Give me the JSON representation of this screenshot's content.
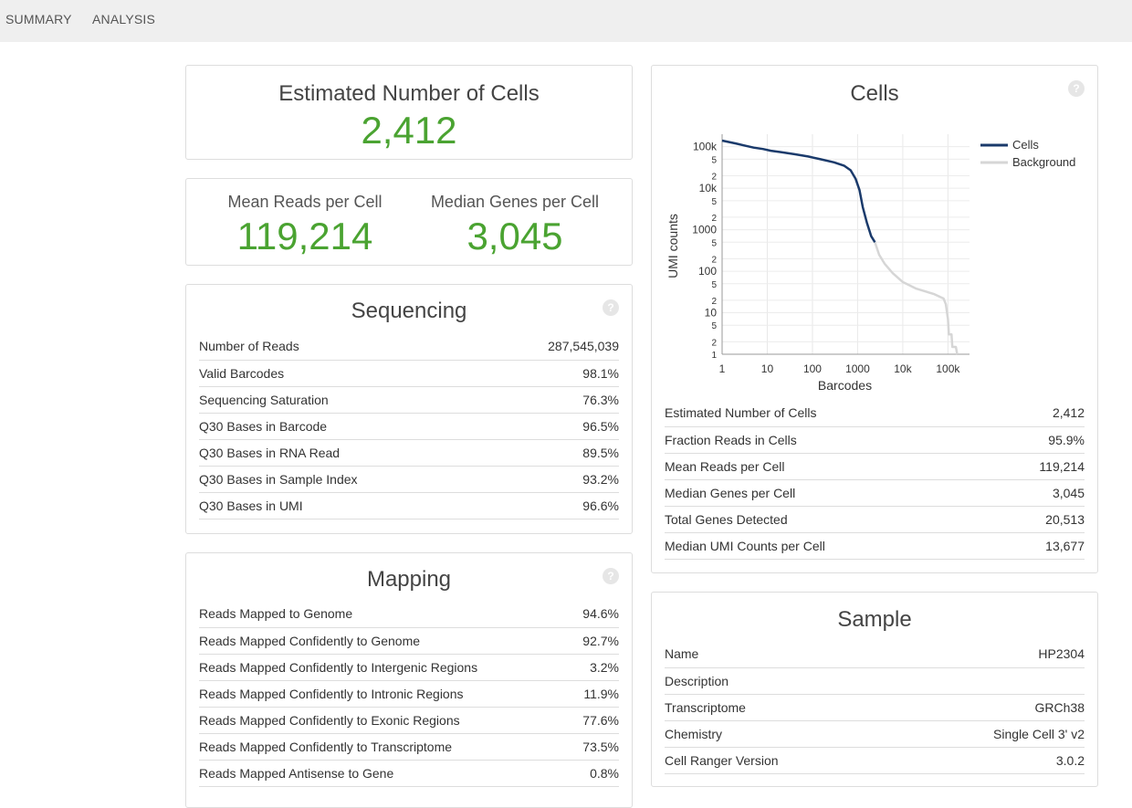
{
  "nav": {
    "tabs": [
      "SUMMARY",
      "ANALYSIS"
    ]
  },
  "estimated_cells": {
    "title": "Estimated Number of Cells",
    "value": "2,412"
  },
  "kpis": [
    {
      "label": "Mean Reads per Cell",
      "value": "119,214"
    },
    {
      "label": "Median Genes per Cell",
      "value": "3,045"
    }
  ],
  "sequencing": {
    "title": "Sequencing",
    "rows": [
      {
        "label": "Number of Reads",
        "value": "287,545,039"
      },
      {
        "label": "Valid Barcodes",
        "value": "98.1%"
      },
      {
        "label": "Sequencing Saturation",
        "value": "76.3%"
      },
      {
        "label": "Q30 Bases in Barcode",
        "value": "96.5%"
      },
      {
        "label": "Q30 Bases in RNA Read",
        "value": "89.5%"
      },
      {
        "label": "Q30 Bases in Sample Index",
        "value": "93.2%"
      },
      {
        "label": "Q30 Bases in UMI",
        "value": "96.6%"
      }
    ]
  },
  "mapping": {
    "title": "Mapping",
    "rows": [
      {
        "label": "Reads Mapped to Genome",
        "value": "94.6%"
      },
      {
        "label": "Reads Mapped Confidently to Genome",
        "value": "92.7%"
      },
      {
        "label": "Reads Mapped Confidently to Intergenic Regions",
        "value": "3.2%"
      },
      {
        "label": "Reads Mapped Confidently to Intronic Regions",
        "value": "11.9%"
      },
      {
        "label": "Reads Mapped Confidently to Exonic Regions",
        "value": "77.6%"
      },
      {
        "label": "Reads Mapped Confidently to Transcriptome",
        "value": "73.5%"
      },
      {
        "label": "Reads Mapped Antisense to Gene",
        "value": "0.8%"
      }
    ]
  },
  "cells": {
    "title": "Cells",
    "rows": [
      {
        "label": "Estimated Number of Cells",
        "value": "2,412"
      },
      {
        "label": "Fraction Reads in Cells",
        "value": "95.9%"
      },
      {
        "label": "Mean Reads per Cell",
        "value": "119,214"
      },
      {
        "label": "Median Genes per Cell",
        "value": "3,045"
      },
      {
        "label": "Total Genes Detected",
        "value": "20,513"
      },
      {
        "label": "Median UMI Counts per Cell",
        "value": "13,677"
      }
    ]
  },
  "sample": {
    "title": "Sample",
    "rows": [
      {
        "label": "Name",
        "value": "HP2304"
      },
      {
        "label": "Description",
        "value": ""
      },
      {
        "label": "Transcriptome",
        "value": "GRCh38"
      },
      {
        "label": "Chemistry",
        "value": "Single Cell 3' v2"
      },
      {
        "label": "Cell Ranger Version",
        "value": "3.0.2"
      }
    ]
  },
  "help_icon": {
    "glyph": "?",
    "icon": "question-circle-icon"
  },
  "colors": {
    "accent_green": "#4aa331",
    "cells_series": "#1a3a6b",
    "background_series": "#d6d6d6",
    "topbar": "#efefef"
  },
  "chart_data": {
    "type": "line",
    "xlabel": "Barcodes",
    "ylabel": "UMI counts",
    "xscale": "log",
    "yscale": "log",
    "xlim": [
      1,
      300000
    ],
    "ylim": [
      1,
      200000
    ],
    "grid": true,
    "legend_position": "top-right",
    "x_ticks": [
      {
        "value": 1,
        "label": "1"
      },
      {
        "value": 10,
        "label": "10"
      },
      {
        "value": 100,
        "label": "100"
      },
      {
        "value": 1000,
        "label": "1000"
      },
      {
        "value": 10000,
        "label": "10k"
      },
      {
        "value": 100000,
        "label": "100k"
      }
    ],
    "y_ticks": [
      {
        "value": 1,
        "label": "1"
      },
      {
        "value": 2,
        "label": "2"
      },
      {
        "value": 5,
        "label": "5"
      },
      {
        "value": 10,
        "label": "10"
      },
      {
        "value": 20,
        "label": "2"
      },
      {
        "value": 50,
        "label": "5"
      },
      {
        "value": 100,
        "label": "100"
      },
      {
        "value": 200,
        "label": "2"
      },
      {
        "value": 500,
        "label": "5"
      },
      {
        "value": 1000,
        "label": "1000"
      },
      {
        "value": 2000,
        "label": "2"
      },
      {
        "value": 5000,
        "label": "5"
      },
      {
        "value": 10000,
        "label": "10k"
      },
      {
        "value": 20000,
        "label": "2"
      },
      {
        "value": 50000,
        "label": "5"
      },
      {
        "value": 100000,
        "label": "100k"
      }
    ],
    "series": [
      {
        "name": "Cells",
        "color": "#1a3a6b",
        "points": [
          [
            1,
            140000
          ],
          [
            2,
            120000
          ],
          [
            3,
            108000
          ],
          [
            5,
            95000
          ],
          [
            8,
            88000
          ],
          [
            12,
            80000
          ],
          [
            20,
            74000
          ],
          [
            40,
            66000
          ],
          [
            80,
            58000
          ],
          [
            150,
            50000
          ],
          [
            300,
            42000
          ],
          [
            500,
            35000
          ],
          [
            700,
            27000
          ],
          [
            900,
            17000
          ],
          [
            1100,
            9000
          ],
          [
            1300,
            3500
          ],
          [
            1600,
            1500
          ],
          [
            2000,
            700
          ],
          [
            2412,
            500
          ]
        ]
      },
      {
        "name": "Background",
        "color": "#d6d6d6",
        "points": [
          [
            2412,
            500
          ],
          [
            3000,
            250
          ],
          [
            4000,
            150
          ],
          [
            6000,
            90
          ],
          [
            10000,
            55
          ],
          [
            20000,
            38
          ],
          [
            50000,
            28
          ],
          [
            80000,
            22
          ],
          [
            90000,
            16
          ],
          [
            100000,
            7
          ],
          [
            105000,
            3
          ],
          [
            120000,
            3
          ],
          [
            125000,
            1.5
          ],
          [
            150000,
            1.5
          ],
          [
            160000,
            1
          ]
        ]
      }
    ]
  }
}
